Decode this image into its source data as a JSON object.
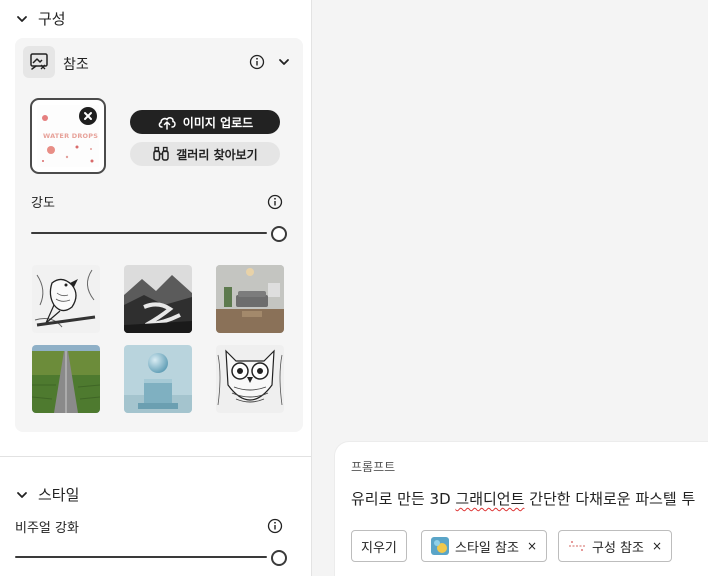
{
  "composition": {
    "title": "구성"
  },
  "reference": {
    "title": "참조",
    "preview_text": "WATER DROPS",
    "upload_label": "이미지 업로드",
    "gallery_label": "갤러리 찾아보기"
  },
  "strength": {
    "label": "강도",
    "value": 1.0
  },
  "gallery_items": [
    "bird-line-art-thumbnail",
    "misty-mountain-lake-thumbnail",
    "living-room-interior-thumbnail",
    "road-through-fields-thumbnail",
    "sphere-on-pedestal-thumbnail",
    "owl-line-art-thumbnail"
  ],
  "style": {
    "title": "스타일"
  },
  "visual_intensity": {
    "label": "비주얼 강화",
    "value": 1.0
  },
  "prompt": {
    "label": "프롬프트",
    "text_before": "유리로 만든 3D ",
    "text_flagged": "그래디언트",
    "text_after": " 간단한 다채로운 파스텔 투",
    "clear_label": "지우기",
    "style_ref_chip": "스타일 참조",
    "comp_ref_chip": "구성 참조",
    "chip_close": "×"
  },
  "colors": {
    "accent_dark": "#222222",
    "panel_bg": "#f5f5f5",
    "spellcheck": "#dd3333"
  }
}
